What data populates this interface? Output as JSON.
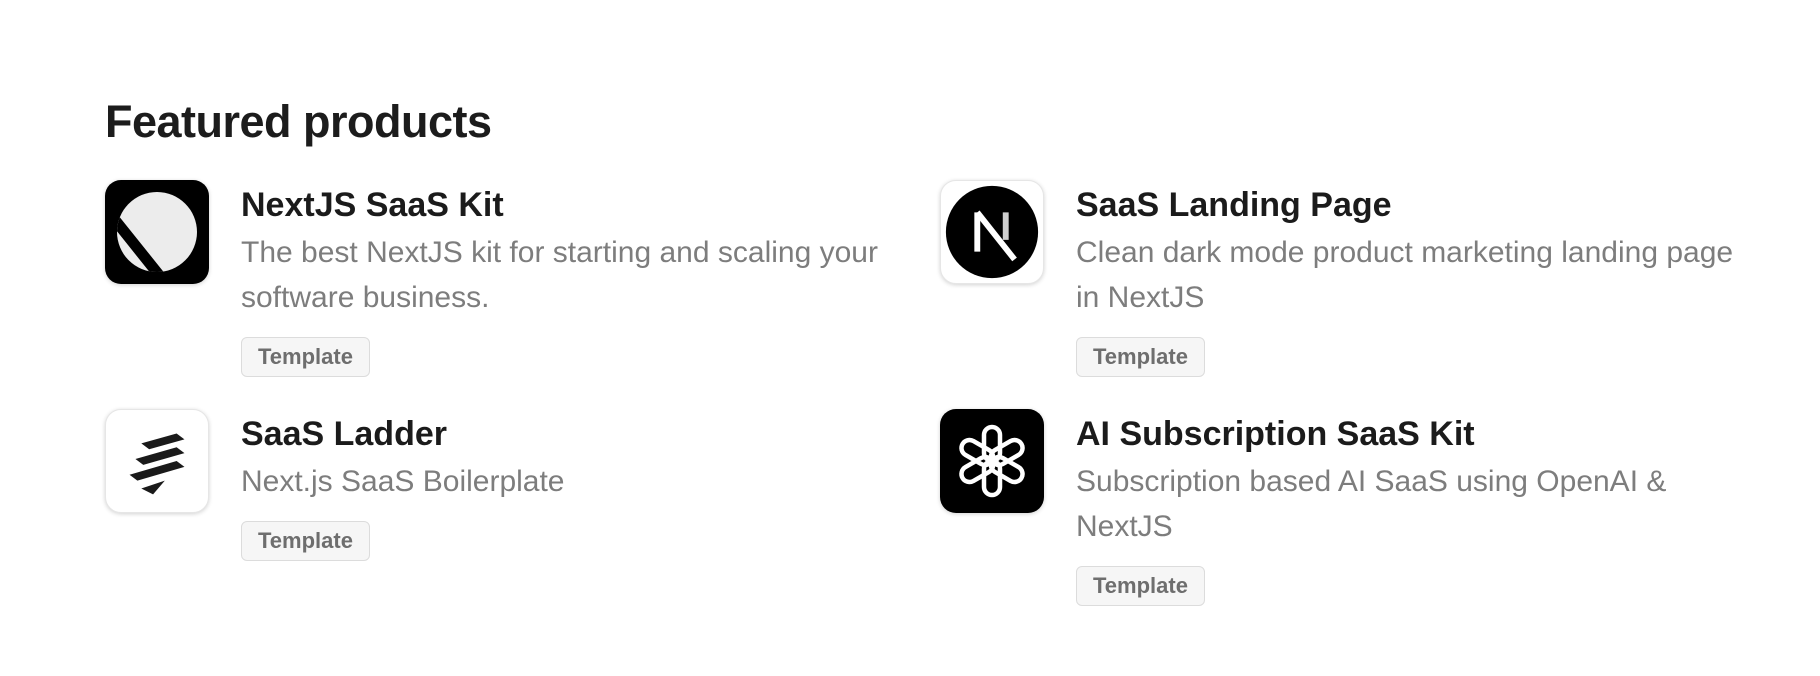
{
  "section": {
    "title": "Featured products"
  },
  "products": [
    {
      "name": "NextJS SaaS Kit",
      "description": "The best NextJS kit for starting and scaling your software business.",
      "tag": "Template",
      "icon": "half-circle-logo-icon"
    },
    {
      "name": "SaaS Landing Page",
      "description": "Clean dark mode product marketing landing page in NextJS",
      "tag": "Template",
      "icon": "nextjs-logo-icon"
    },
    {
      "name": "SaaS Ladder",
      "description": "Next.js SaaS Boilerplate",
      "tag": "Template",
      "icon": "ladder-logo-icon"
    },
    {
      "name": "AI Subscription SaaS Kit",
      "description": "Subscription based AI SaaS using OpenAI & NextJS",
      "tag": "Template",
      "icon": "openai-logo-icon"
    }
  ],
  "colors": {
    "background": "#ffffff",
    "title_text": "#1b1b1b",
    "description_text": "#7d7d7d",
    "badge_background": "#f6f6f6",
    "badge_border": "#dcdcdc"
  }
}
